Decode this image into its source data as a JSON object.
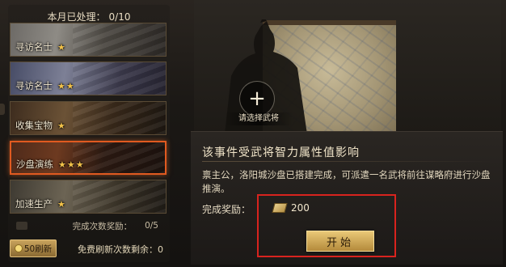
{
  "header": {
    "monthly_label": "本月已处理：",
    "monthly_count": "0/10"
  },
  "quests": [
    {
      "label": "寻访名士",
      "stars": "★"
    },
    {
      "label": "寻访名士",
      "stars": "★★"
    },
    {
      "label": "收集宝物",
      "stars": "★"
    },
    {
      "label": "沙盘演练",
      "stars": "★★★",
      "selected": true
    },
    {
      "label": "加速生产",
      "stars": "★"
    }
  ],
  "progress": {
    "label": "完成次数奖励：",
    "value": "0/5"
  },
  "refresh": {
    "label": "50刷新",
    "icon": "coin-icon"
  },
  "free_refresh": {
    "label": "免费刷新次数剩余：",
    "value": "0"
  },
  "slot": {
    "plus": "+",
    "hint": "请选择武将"
  },
  "event": {
    "title": "该事件受武将智力属性值影响",
    "description": "禀主公，洛阳城沙盘已搭建完成，可派遣一名武将前往谋略府进行沙盘推演。"
  },
  "reward": {
    "label": "完成奖励：",
    "value": "200",
    "icon": "scroll-icon"
  },
  "start_button": {
    "label": "开始"
  },
  "colors": {
    "selection": "#e05a20",
    "highlight_box": "#d8231e",
    "star": "#f2c24a",
    "button_gold": "#e9c877"
  }
}
